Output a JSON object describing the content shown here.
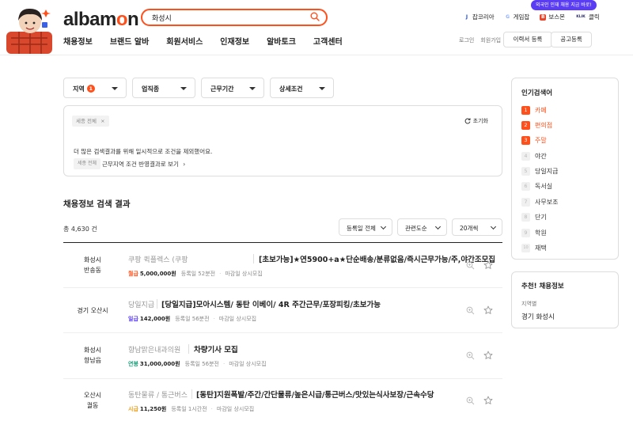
{
  "header": {
    "logo_main": "albam",
    "logo_accent": "o",
    "logo_tail": "n",
    "search_value": "화성시",
    "promo_badge": "외국인 인재 채용 지금 바로!",
    "ext_links": [
      {
        "label": "잡코리아",
        "icon": "J",
        "color": "#1a4bd6"
      },
      {
        "label": "게임잡",
        "icon": "G",
        "color": "#8fb0ff"
      },
      {
        "label": "보스몬",
        "icon": "B",
        "color": "#e8452a"
      },
      {
        "label": "클릭",
        "icon": "KLIK",
        "color": "#2b2b6b"
      }
    ],
    "nav": [
      "채용정보",
      "브랜드 알바",
      "회원서비스",
      "인재정보",
      "알바토크",
      "고객센터"
    ],
    "util": [
      "로그인",
      "회원가입"
    ],
    "resume_button": "이력서 등록",
    "post_button": "공고등록"
  },
  "filters": {
    "region": "지역",
    "region_count": "1",
    "category": "업직종",
    "period": "근무기간",
    "detail": "상세조건",
    "chip": "세종 전체",
    "reset": "초기화",
    "notice": "더 많은 검색결과를 위해 일시적으로 조건을 제외했어요.",
    "chip2": "세종 전체",
    "apply_link": "근무지역 조건 반영결과로 보기"
  },
  "results": {
    "title": "채용정보 검색 결과",
    "total": "총 4,630 건",
    "sort_date": "등록일 전체",
    "sort_order": "관련도순",
    "per_page": "20개씩",
    "jobs": [
      {
        "loc1": "화성시",
        "loc2": "반송동",
        "company": "쿠팡 퀵플렉스 (쿠팡",
        "title": "[초보가능]★연5900+a★단순배송/분류없음/즉시근무가능/주,야간조모집",
        "pay_type": "월급",
        "pay_type_color": "#ff501b",
        "pay": "5,000,000원",
        "registered": "등록일 52분전",
        "deadline": "마감일 상시모집"
      },
      {
        "loc1": "경기 오산시",
        "loc2": "",
        "company": "당일지급",
        "title": "[당일지급]모아시스템/ 동탄 이베이/ 4R 주간근무/포장피킹/초보가능",
        "pay_type": "일급",
        "pay_type_color": "#5b3cf5",
        "pay": "142,000원",
        "registered": "등록일 56분전",
        "deadline": "마감일 상시모집"
      },
      {
        "loc1": "화성시",
        "loc2": "향남읍",
        "company": "향남맑은내과의원",
        "title": "차량기사 모집",
        "pay_type": "연봉",
        "pay_type_color": "#1a9e7a",
        "pay": "31,000,000원",
        "registered": "등록일 56분전",
        "deadline": "마감일 상시모집"
      },
      {
        "loc1": "오산시",
        "loc2": "궐동",
        "company": "동탄물류 / 통근버스",
        "title": "[동탄]지원폭발/주간/간단물류/높은시급/통근버스/맛있는식사보장/근속수당",
        "pay_type": "시급",
        "pay_type_color": "#e8a01e",
        "pay": "11,250원",
        "registered": "등록일 1시간전",
        "deadline": "마감일 상시모집"
      }
    ]
  },
  "sidebar": {
    "popular_title": "인기검색어",
    "popular": [
      "카페",
      "편의점",
      "주말",
      "야간",
      "당일지급",
      "독서실",
      "사무보조",
      "단기",
      "학원",
      "재택"
    ],
    "rec_title": "추천! 채용정보",
    "rec_sub": "지역별",
    "rec_loc": "경기 화성시"
  }
}
